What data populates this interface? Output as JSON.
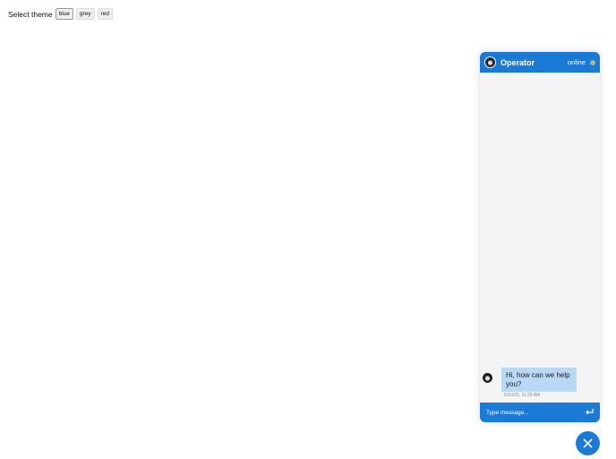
{
  "theme_selector": {
    "label": "Select theme",
    "options": [
      "blue",
      "grey",
      "red"
    ],
    "selected": "blue"
  },
  "chat": {
    "header": {
      "name": "Operator",
      "status": "online"
    },
    "messages": [
      {
        "text": "Hi, how can we help you?",
        "time": "6/10/25, 11:35 AM"
      }
    ],
    "input": {
      "placeholder": "Type message..."
    }
  },
  "colors": {
    "accent": "#1b7ad6",
    "bubble": "#b9d8f5",
    "online": "#9fb98a"
  }
}
